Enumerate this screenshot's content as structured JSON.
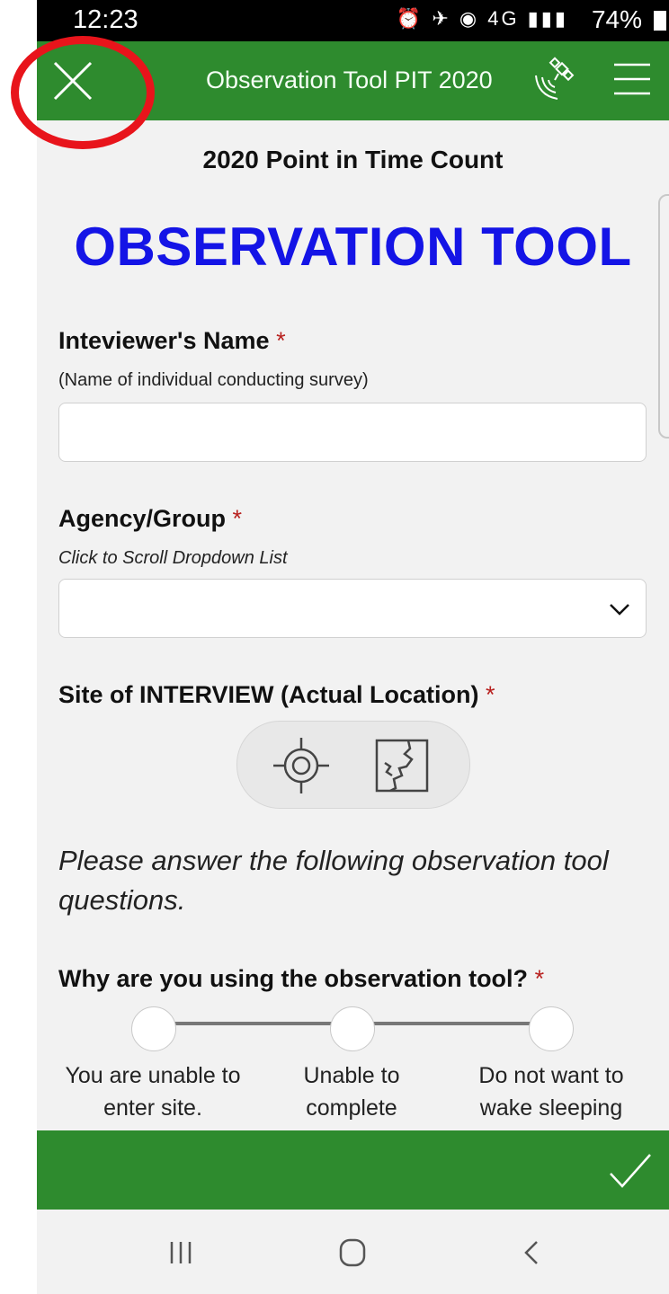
{
  "status_bar": {
    "time": "12:23",
    "icons": "⏰ ✈ ◉ 4G ▮▮▮",
    "battery": "74%"
  },
  "app_bar": {
    "title": "Observation Tool PIT 2020"
  },
  "form": {
    "subtitle": "2020 Point in Time Count",
    "title": "OBSERVATION TOOL",
    "fields": [
      {
        "label": "Inteviewer's Name",
        "required_mark": "*",
        "hint": "(Name of individual conducting survey)",
        "value": ""
      },
      {
        "label": "Agency/Group",
        "required_mark": "*",
        "hint": "Click to Scroll Dropdown List",
        "value": ""
      },
      {
        "label": "Site of INTERVIEW (Actual Location)",
        "required_mark": "*"
      }
    ],
    "intro_text": "Please answer the following observation tool questions.",
    "question": {
      "label": "Why are you using the observation tool?",
      "required_mark": "*",
      "options": [
        "You are unable to enter site.",
        "Unable to complete",
        "Do not want to wake sleeping"
      ]
    }
  },
  "colors": {
    "accent_green": "#2e8b2e",
    "title_blue": "#1414e6",
    "required_red": "#b8211f",
    "highlight_red": "#e8141b"
  },
  "icons": [
    "close-icon",
    "gps-satellite-icon",
    "menu-icon",
    "chevron-down-icon",
    "location-target-icon",
    "map-icon",
    "check-icon",
    "recent-apps-icon",
    "home-icon",
    "back-icon"
  ]
}
